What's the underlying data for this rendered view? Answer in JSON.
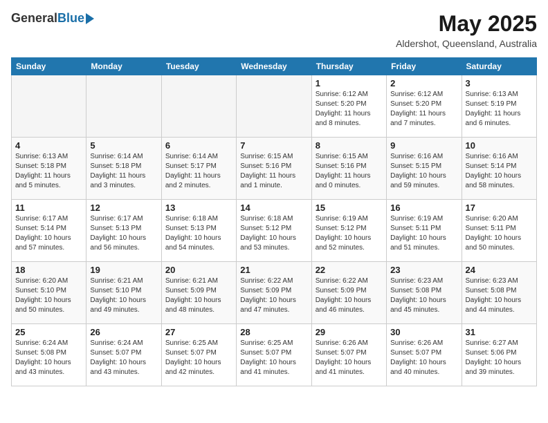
{
  "header": {
    "logo_general": "General",
    "logo_blue": "Blue",
    "month_title": "May 2025",
    "location": "Aldershot, Queensland, Australia"
  },
  "days_of_week": [
    "Sunday",
    "Monday",
    "Tuesday",
    "Wednesday",
    "Thursday",
    "Friday",
    "Saturday"
  ],
  "weeks": [
    [
      {
        "day": "",
        "info": ""
      },
      {
        "day": "",
        "info": ""
      },
      {
        "day": "",
        "info": ""
      },
      {
        "day": "",
        "info": ""
      },
      {
        "day": "1",
        "info": "Sunrise: 6:12 AM\nSunset: 5:20 PM\nDaylight: 11 hours\nand 8 minutes."
      },
      {
        "day": "2",
        "info": "Sunrise: 6:12 AM\nSunset: 5:20 PM\nDaylight: 11 hours\nand 7 minutes."
      },
      {
        "day": "3",
        "info": "Sunrise: 6:13 AM\nSunset: 5:19 PM\nDaylight: 11 hours\nand 6 minutes."
      }
    ],
    [
      {
        "day": "4",
        "info": "Sunrise: 6:13 AM\nSunset: 5:18 PM\nDaylight: 11 hours\nand 5 minutes."
      },
      {
        "day": "5",
        "info": "Sunrise: 6:14 AM\nSunset: 5:18 PM\nDaylight: 11 hours\nand 3 minutes."
      },
      {
        "day": "6",
        "info": "Sunrise: 6:14 AM\nSunset: 5:17 PM\nDaylight: 11 hours\nand 2 minutes."
      },
      {
        "day": "7",
        "info": "Sunrise: 6:15 AM\nSunset: 5:16 PM\nDaylight: 11 hours\nand 1 minute."
      },
      {
        "day": "8",
        "info": "Sunrise: 6:15 AM\nSunset: 5:16 PM\nDaylight: 11 hours\nand 0 minutes."
      },
      {
        "day": "9",
        "info": "Sunrise: 6:16 AM\nSunset: 5:15 PM\nDaylight: 10 hours\nand 59 minutes."
      },
      {
        "day": "10",
        "info": "Sunrise: 6:16 AM\nSunset: 5:14 PM\nDaylight: 10 hours\nand 58 minutes."
      }
    ],
    [
      {
        "day": "11",
        "info": "Sunrise: 6:17 AM\nSunset: 5:14 PM\nDaylight: 10 hours\nand 57 minutes."
      },
      {
        "day": "12",
        "info": "Sunrise: 6:17 AM\nSunset: 5:13 PM\nDaylight: 10 hours\nand 56 minutes."
      },
      {
        "day": "13",
        "info": "Sunrise: 6:18 AM\nSunset: 5:13 PM\nDaylight: 10 hours\nand 54 minutes."
      },
      {
        "day": "14",
        "info": "Sunrise: 6:18 AM\nSunset: 5:12 PM\nDaylight: 10 hours\nand 53 minutes."
      },
      {
        "day": "15",
        "info": "Sunrise: 6:19 AM\nSunset: 5:12 PM\nDaylight: 10 hours\nand 52 minutes."
      },
      {
        "day": "16",
        "info": "Sunrise: 6:19 AM\nSunset: 5:11 PM\nDaylight: 10 hours\nand 51 minutes."
      },
      {
        "day": "17",
        "info": "Sunrise: 6:20 AM\nSunset: 5:11 PM\nDaylight: 10 hours\nand 50 minutes."
      }
    ],
    [
      {
        "day": "18",
        "info": "Sunrise: 6:20 AM\nSunset: 5:10 PM\nDaylight: 10 hours\nand 50 minutes."
      },
      {
        "day": "19",
        "info": "Sunrise: 6:21 AM\nSunset: 5:10 PM\nDaylight: 10 hours\nand 49 minutes."
      },
      {
        "day": "20",
        "info": "Sunrise: 6:21 AM\nSunset: 5:09 PM\nDaylight: 10 hours\nand 48 minutes."
      },
      {
        "day": "21",
        "info": "Sunrise: 6:22 AM\nSunset: 5:09 PM\nDaylight: 10 hours\nand 47 minutes."
      },
      {
        "day": "22",
        "info": "Sunrise: 6:22 AM\nSunset: 5:09 PM\nDaylight: 10 hours\nand 46 minutes."
      },
      {
        "day": "23",
        "info": "Sunrise: 6:23 AM\nSunset: 5:08 PM\nDaylight: 10 hours\nand 45 minutes."
      },
      {
        "day": "24",
        "info": "Sunrise: 6:23 AM\nSunset: 5:08 PM\nDaylight: 10 hours\nand 44 minutes."
      }
    ],
    [
      {
        "day": "25",
        "info": "Sunrise: 6:24 AM\nSunset: 5:08 PM\nDaylight: 10 hours\nand 43 minutes."
      },
      {
        "day": "26",
        "info": "Sunrise: 6:24 AM\nSunset: 5:07 PM\nDaylight: 10 hours\nand 43 minutes."
      },
      {
        "day": "27",
        "info": "Sunrise: 6:25 AM\nSunset: 5:07 PM\nDaylight: 10 hours\nand 42 minutes."
      },
      {
        "day": "28",
        "info": "Sunrise: 6:25 AM\nSunset: 5:07 PM\nDaylight: 10 hours\nand 41 minutes."
      },
      {
        "day": "29",
        "info": "Sunrise: 6:26 AM\nSunset: 5:07 PM\nDaylight: 10 hours\nand 41 minutes."
      },
      {
        "day": "30",
        "info": "Sunrise: 6:26 AM\nSunset: 5:07 PM\nDaylight: 10 hours\nand 40 minutes."
      },
      {
        "day": "31",
        "info": "Sunrise: 6:27 AM\nSunset: 5:06 PM\nDaylight: 10 hours\nand 39 minutes."
      }
    ]
  ]
}
